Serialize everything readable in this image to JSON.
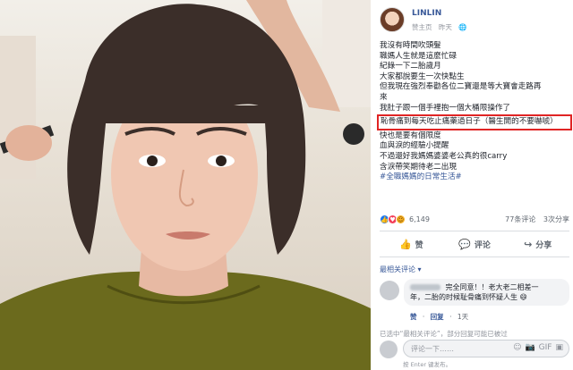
{
  "post": {
    "author": "LINLIN",
    "meta_a": "赞主页",
    "meta_b": "昨天",
    "lines": [
      "我沒有時間吹頭髮",
      "職媽人生就是這麼忙碌",
      "紀錄一下二胎歲月",
      "大家都說要生一次快點生",
      "但我現在強烈奉勸各位二寶還是等大寶會走路再",
      "來",
      "我肚子跟一個手裡抱一個大桶限操作了"
    ],
    "highlight": "恥骨痛到每天吃止痛藥過日子（醫生開的不要嚇唬）",
    "lines_after": [
      "快也是要有個限度",
      "血與淚的經驗小提醒",
      "不過還好我媽媽婆婆老公真的很carry",
      "含淚帶笑期待老二出現"
    ],
    "hashtag": "#全職媽媽的日常生活#"
  },
  "stats": {
    "reactions": "6,149",
    "comments": "77条评论",
    "shares": "3次分享"
  },
  "actions": {
    "like": "赞",
    "comment": "评论",
    "share": "分享"
  },
  "sort_label": "最相关评论",
  "comment": {
    "text_a": "完全同意！！老大老二相差一",
    "text_b": "年，二胎的时候耻骨痛到怀疑人生",
    "like_label": "赞",
    "reply_label": "回复",
    "age": "1天"
  },
  "more_comments": "已选中“最相关评论”，部分回复可能已被过",
  "compose": {
    "placeholder": "评论一下……",
    "hint": "按 Enter 键发布。"
  },
  "icons": [
    "camera-icon",
    "gif-icon",
    "sticker-icon",
    "emoji-icon",
    "like-icon",
    "comment-icon",
    "share-icon"
  ]
}
